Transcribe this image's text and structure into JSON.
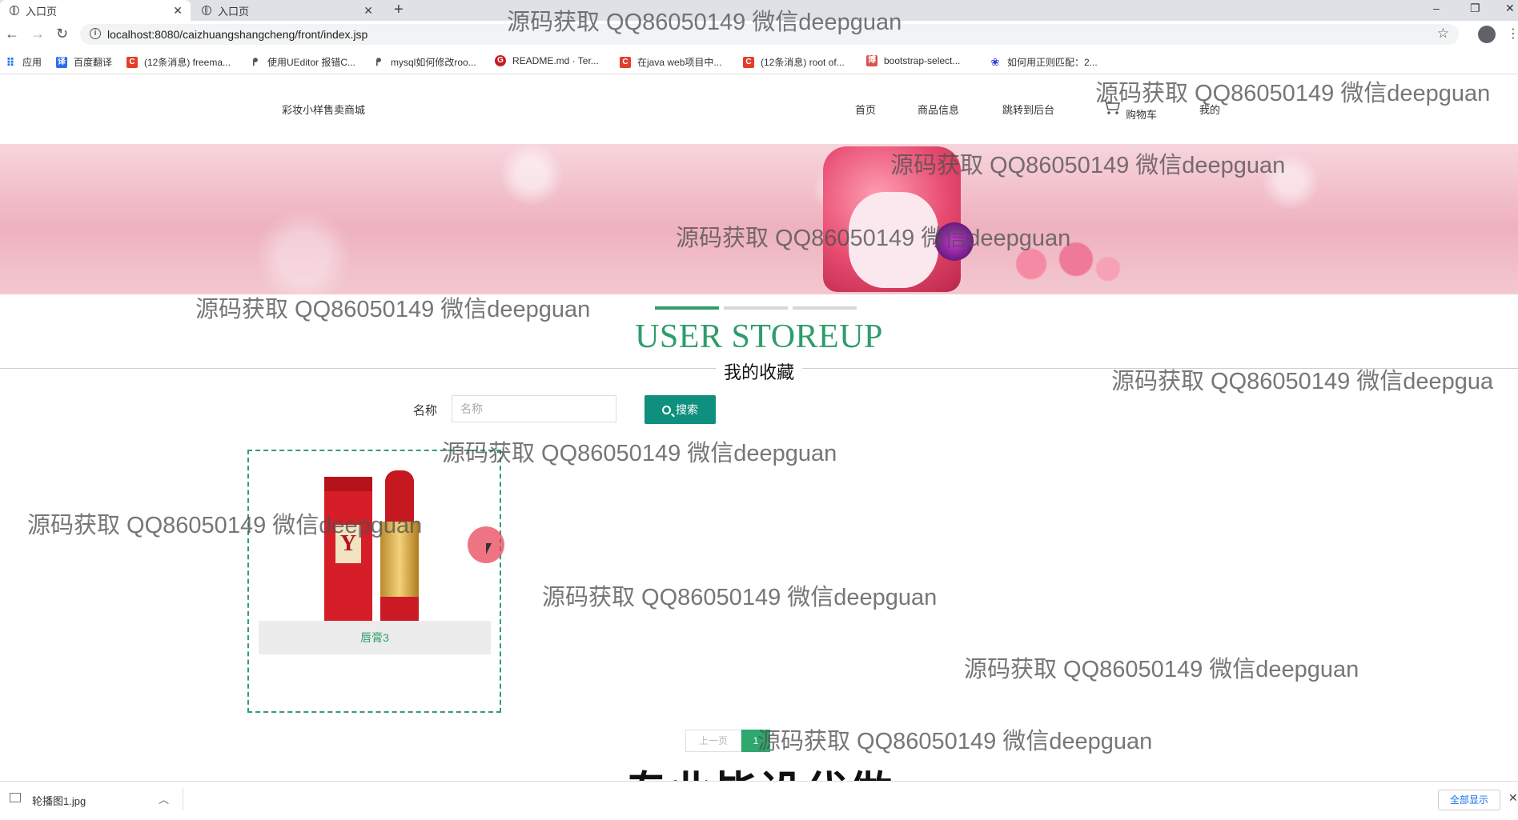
{
  "browser": {
    "tabs": [
      {
        "title": "入口页",
        "active": true
      },
      {
        "title": "入口页",
        "active": false
      }
    ],
    "url": "localhost:8080/caizhuangshangcheng/front/index.jsp",
    "bookmarks": [
      {
        "label": "应用",
        "icon": "apps-grid-icon",
        "color": "#1a73e8"
      },
      {
        "label": "百度翻译",
        "icon": "baidu-translate-icon",
        "color": "#2b6de9"
      },
      {
        "label": "(12条消息) freema...",
        "icon": "csdn-icon",
        "color": "#e33e2b"
      },
      {
        "label": "使用UEditor 报错C...",
        "icon": "ueditor-icon",
        "color": "#555555"
      },
      {
        "label": "mysql如何修改roo...",
        "icon": "mysql-icon",
        "color": "#555555"
      },
      {
        "label": "README.md · Ter...",
        "icon": "gitee-icon",
        "color": "#c71d23"
      },
      {
        "label": "在java web项目中...",
        "icon": "csdn-icon",
        "color": "#e33e2b"
      },
      {
        "label": "(12条消息) root of...",
        "icon": "csdn-icon",
        "color": "#e33e2b"
      },
      {
        "label": "bootstrap-select...",
        "icon": "cnblogs-icon",
        "color": "#d9534f"
      },
      {
        "label": "如何用正则匹配：2...",
        "icon": "baidu-paw-icon",
        "color": "#2932e1"
      }
    ]
  },
  "site": {
    "title": "彩妆小样售卖商城",
    "nav": [
      "首页",
      "商品信息",
      "跳转到后台",
      "购物车",
      "我的"
    ]
  },
  "section": {
    "title_en": "USER STOREUP",
    "title_cn": "我的收藏"
  },
  "search": {
    "label": "名称",
    "placeholder": "名称",
    "value": "",
    "button": "搜索"
  },
  "products": [
    {
      "name": "唇膏3"
    }
  ],
  "pagination": {
    "prev": "上一页",
    "current": "1"
  },
  "watermarks": {
    "text": "源码获取 QQ86050149 微信deepguan",
    "text_cut": "源码获取 QQ86050149 微信deepgua",
    "banner": "专业毕设代做"
  },
  "downloads": {
    "file": "轮播图1.jpg",
    "show_all": "全部显示"
  },
  "colors": {
    "accent_green": "#2e9d69",
    "search_button": "#0f8f7e",
    "banner_pink": "#eeb1bf"
  }
}
